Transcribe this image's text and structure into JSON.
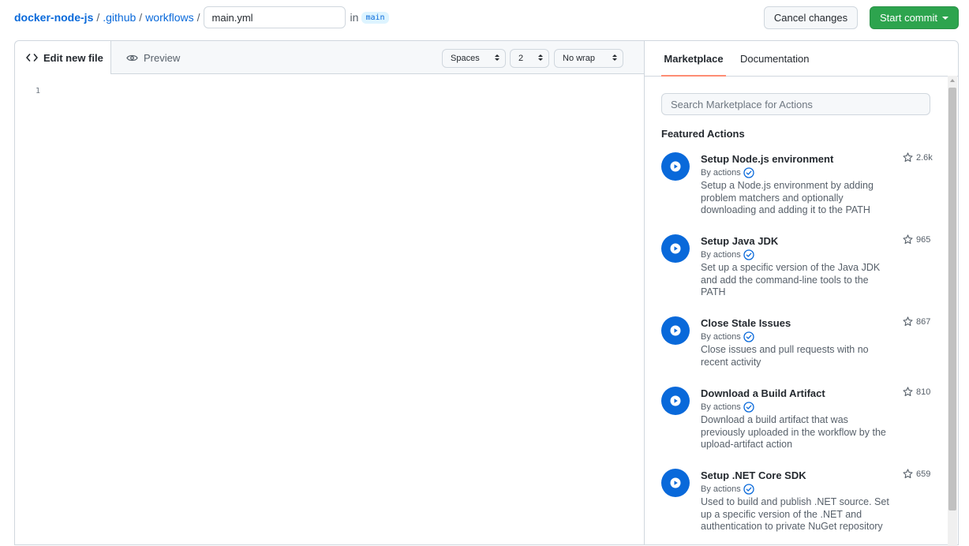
{
  "breadcrumb": {
    "repo": "docker-node-js",
    "sep1": "/",
    "folder1": ".github",
    "sep2": "/",
    "folder2": "workflows",
    "sep3": "/",
    "filename": "main.yml",
    "in_word": "in",
    "branch": "main"
  },
  "buttons": {
    "cancel": "Cancel changes",
    "commit": "Start commit"
  },
  "editor": {
    "tab_edit": "Edit new file",
    "tab_preview": "Preview",
    "indent_mode": "Spaces",
    "indent_size": "2",
    "wrap_mode": "No wrap",
    "line_number": "1"
  },
  "sidebar": {
    "tab_marketplace": "Marketplace",
    "tab_documentation": "Documentation",
    "search_placeholder": "Search Marketplace for Actions",
    "featured_heading": "Featured Actions",
    "actions": [
      {
        "name": "Setup Node.js environment",
        "by": "By actions",
        "description": "Setup a Node.js environment by adding problem matchers and optionally downloading and adding it to the PATH",
        "stars": "2.6k"
      },
      {
        "name": "Setup Java JDK",
        "by": "By actions",
        "description": "Set up a specific version of the Java JDK and add the command-line tools to the PATH",
        "stars": "965"
      },
      {
        "name": "Close Stale Issues",
        "by": "By actions",
        "description": "Close issues and pull requests with no recent activity",
        "stars": "867"
      },
      {
        "name": "Download a Build Artifact",
        "by": "By actions",
        "description": "Download a build artifact that was previously uploaded in the workflow by the upload-artifact action",
        "stars": "810"
      },
      {
        "name": "Setup .NET Core SDK",
        "by": "By actions",
        "description": "Used to build and publish .NET source. Set up a specific version of the .NET and authentication to private NuGet repository",
        "stars": "659"
      }
    ]
  },
  "colors": {
    "link": "#0969da",
    "commit_green": "#2da44e",
    "tab_underline": "#fd8c73",
    "action_icon_bg": "#0969da"
  }
}
